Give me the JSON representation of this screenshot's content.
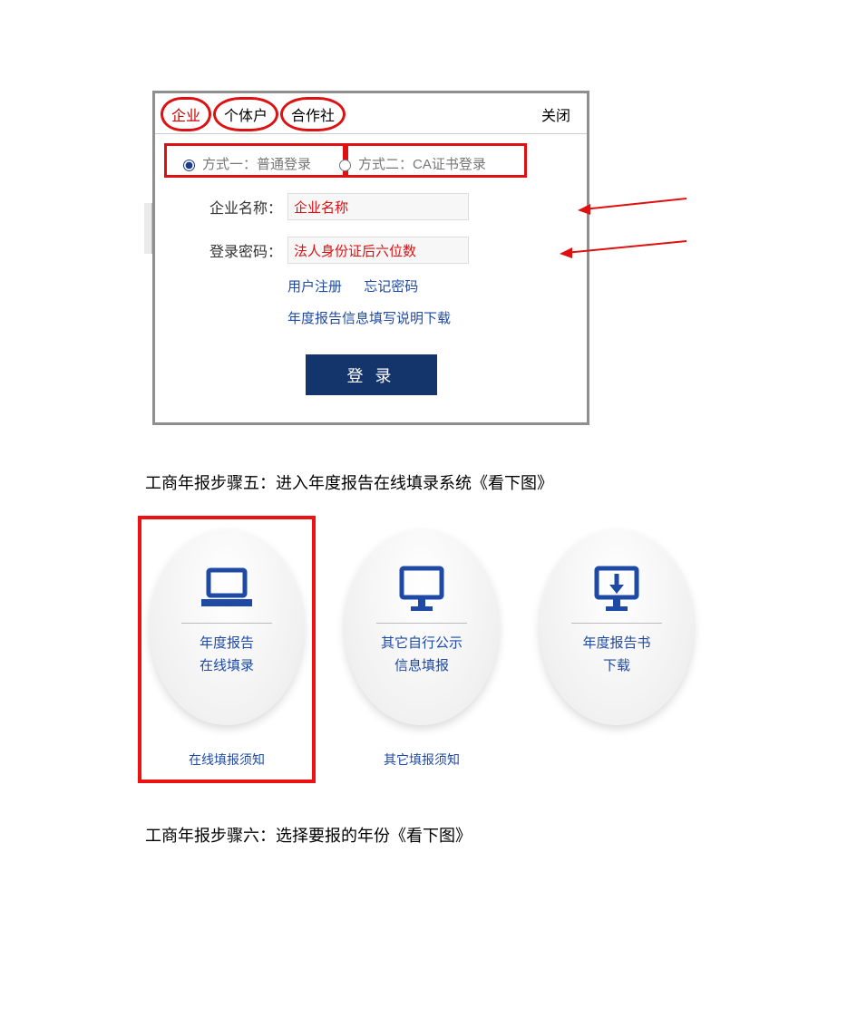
{
  "login": {
    "tabs": {
      "enterprise": "企业",
      "individual": "个体户",
      "coop": "合作社",
      "close": "关闭"
    },
    "modes": {
      "normal": "方式一：普通登录",
      "ca": "方式二：CA证书登录"
    },
    "fields": {
      "name_label": "企业名称：",
      "name_hint": "企业名称",
      "pwd_label": "登录密码：",
      "pwd_hint": "法人身份证后六位数"
    },
    "links": {
      "register": "用户注册",
      "forgot": "忘记密码",
      "download": "年度报告信息填写说明下载"
    },
    "login_btn": "登 录"
  },
  "step5_heading": "工商年报步骤五：进入年度报告在线填录系统《看下图》",
  "cards": {
    "c1": {
      "t1": "年度报告",
      "t2": "在线填录",
      "sub": "在线填报须知"
    },
    "c2": {
      "t1": "其它自行公示",
      "t2": "信息填报",
      "sub": "其它填报须知"
    },
    "c3": {
      "t1": "年度报告书",
      "t2": "下载"
    }
  },
  "step6_heading": "工商年报步骤六：选择要报的年份《看下图》"
}
